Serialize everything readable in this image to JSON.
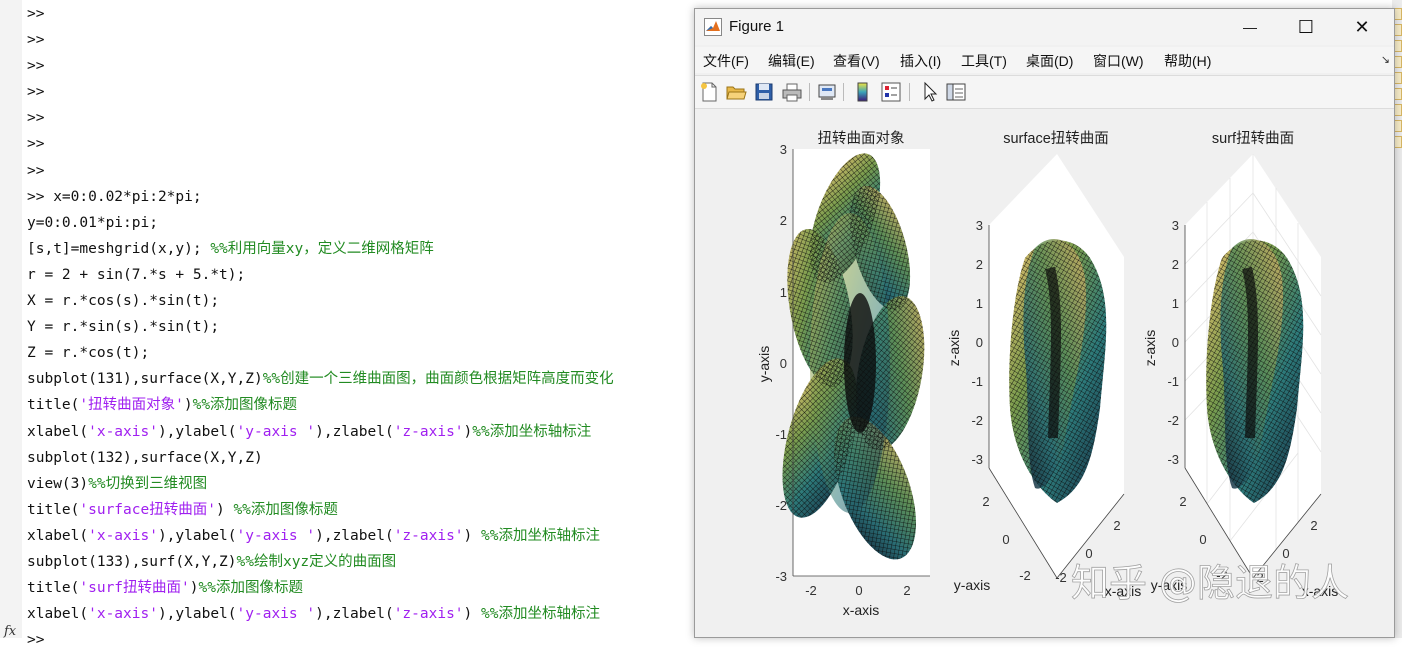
{
  "command_window": {
    "lines": [
      [
        {
          "t": ">>",
          "c": ""
        }
      ],
      [
        {
          "t": ">>",
          "c": ""
        }
      ],
      [
        {
          "t": ">>",
          "c": ""
        }
      ],
      [
        {
          "t": ">>",
          "c": ""
        }
      ],
      [
        {
          "t": ">>",
          "c": ""
        }
      ],
      [
        {
          "t": ">>",
          "c": ""
        }
      ],
      [
        {
          "t": ">>",
          "c": ""
        }
      ],
      [
        {
          "t": ">> x=0:0.02*pi:2*pi;",
          "c": ""
        }
      ],
      [
        {
          "t": "y=0:0.01*pi:pi;",
          "c": ""
        }
      ],
      [
        {
          "t": "[s,t]=meshgrid(x,y); ",
          "c": ""
        },
        {
          "t": "%%利用向量xy，定义二维网格矩阵",
          "c": "cm"
        }
      ],
      [
        {
          "t": "r = 2 + sin(7.*s + 5.*t);",
          "c": ""
        }
      ],
      [
        {
          "t": "X = r.*cos(s).*sin(t);",
          "c": ""
        }
      ],
      [
        {
          "t": "Y = r.*sin(s).*sin(t);",
          "c": ""
        }
      ],
      [
        {
          "t": "Z = r.*cos(t);",
          "c": ""
        }
      ],
      [
        {
          "t": "subplot(131),surface(X,Y,Z)",
          "c": ""
        },
        {
          "t": "%%创建一个三维曲面图，曲面颜色根据矩阵高度而变化",
          "c": "cm"
        }
      ],
      [
        {
          "t": "title(",
          "c": ""
        },
        {
          "t": "'扭转曲面对象'",
          "c": "st"
        },
        {
          "t": ")",
          "c": ""
        },
        {
          "t": "%%添加图像标题",
          "c": "cm"
        }
      ],
      [
        {
          "t": "xlabel(",
          "c": ""
        },
        {
          "t": "'x-axis'",
          "c": "st"
        },
        {
          "t": "),ylabel(",
          "c": ""
        },
        {
          "t": "'y-axis '",
          "c": "st"
        },
        {
          "t": "),zlabel(",
          "c": ""
        },
        {
          "t": "'z-axis'",
          "c": "st"
        },
        {
          "t": ")",
          "c": ""
        },
        {
          "t": "%%添加坐标轴标注",
          "c": "cm"
        }
      ],
      [
        {
          "t": "subplot(132),surface(X,Y,Z)",
          "c": ""
        }
      ],
      [
        {
          "t": "view(3)",
          "c": ""
        },
        {
          "t": "%%切换到三维视图",
          "c": "cm"
        }
      ],
      [
        {
          "t": "title(",
          "c": ""
        },
        {
          "t": "'surface扭转曲面'",
          "c": "st"
        },
        {
          "t": ") ",
          "c": ""
        },
        {
          "t": "%%添加图像标题",
          "c": "cm"
        }
      ],
      [
        {
          "t": "xlabel(",
          "c": ""
        },
        {
          "t": "'x-axis'",
          "c": "st"
        },
        {
          "t": "),ylabel(",
          "c": ""
        },
        {
          "t": "'y-axis '",
          "c": "st"
        },
        {
          "t": "),zlabel(",
          "c": ""
        },
        {
          "t": "'z-axis'",
          "c": "st"
        },
        {
          "t": ") ",
          "c": ""
        },
        {
          "t": "%%添加坐标轴标注",
          "c": "cm"
        }
      ],
      [
        {
          "t": "subplot(133),surf(X,Y,Z)",
          "c": ""
        },
        {
          "t": "%%绘制xyz定义的曲面图",
          "c": "cm"
        }
      ],
      [
        {
          "t": "title(",
          "c": ""
        },
        {
          "t": "'surf扭转曲面'",
          "c": "st"
        },
        {
          "t": ")",
          "c": ""
        },
        {
          "t": "%%添加图像标题",
          "c": "cm"
        }
      ],
      [
        {
          "t": "xlabel(",
          "c": ""
        },
        {
          "t": "'x-axis'",
          "c": "st"
        },
        {
          "t": "),ylabel(",
          "c": ""
        },
        {
          "t": "'y-axis '",
          "c": "st"
        },
        {
          "t": "),zlabel(",
          "c": ""
        },
        {
          "t": "'z-axis'",
          "c": "st"
        },
        {
          "t": ") ",
          "c": ""
        },
        {
          "t": "%%添加坐标轴标注",
          "c": "cm"
        }
      ],
      [
        {
          "t": ">>",
          "c": ""
        }
      ]
    ],
    "fx_label": "fx",
    "colors": {
      "comment": "#228b22",
      "string": "#a020f0",
      "text": "#111111"
    }
  },
  "figure_window": {
    "title": "Figure 1",
    "controls": {
      "minimize": "—",
      "maximize": "☐",
      "close": "✕"
    },
    "menu": [
      "文件(F)",
      "编辑(E)",
      "查看(V)",
      "插入(I)",
      "工具(T)",
      "桌面(D)",
      "窗口(W)",
      "帮助(H)"
    ],
    "toolbar_icons": [
      "new-figure-icon",
      "open-file-icon",
      "save-icon",
      "print-icon",
      "print-preview-icon",
      "colorbar-icon",
      "legend-icon",
      "pointer-icon",
      "property-editor-icon"
    ],
    "subplots": [
      {
        "title": "扭转曲面对象",
        "xlabel": "x-axis",
        "ylabel": "y-axis",
        "xticks": [
          "-2",
          "0",
          "2"
        ],
        "yticks": [
          "3",
          "2",
          "1",
          "0",
          "-1",
          "-2",
          "-3"
        ]
      },
      {
        "title": "surface扭转曲面",
        "ylabel": "y-axis",
        "zlabel": "z-axis",
        "zticks": [
          "3",
          "2",
          "1",
          "0",
          "-1",
          "-2",
          "-3"
        ],
        "yticks": [
          "2",
          "0",
          "-2"
        ],
        "xticks": [
          "2",
          "0",
          "-2"
        ],
        "xlabel": "x-axis"
      },
      {
        "title": "surf扭转曲面",
        "ylabel": "y-axis",
        "zlabel": "z-axis",
        "zticks": [
          "3",
          "2",
          "1",
          "0",
          "-1",
          "-2",
          "-3"
        ],
        "yticks": [
          "2",
          "0",
          "-2"
        ],
        "xticks": [
          "2",
          "0",
          "-2"
        ],
        "xlabel": "x-axis"
      }
    ]
  },
  "watermark": "知乎 @隐退的人"
}
